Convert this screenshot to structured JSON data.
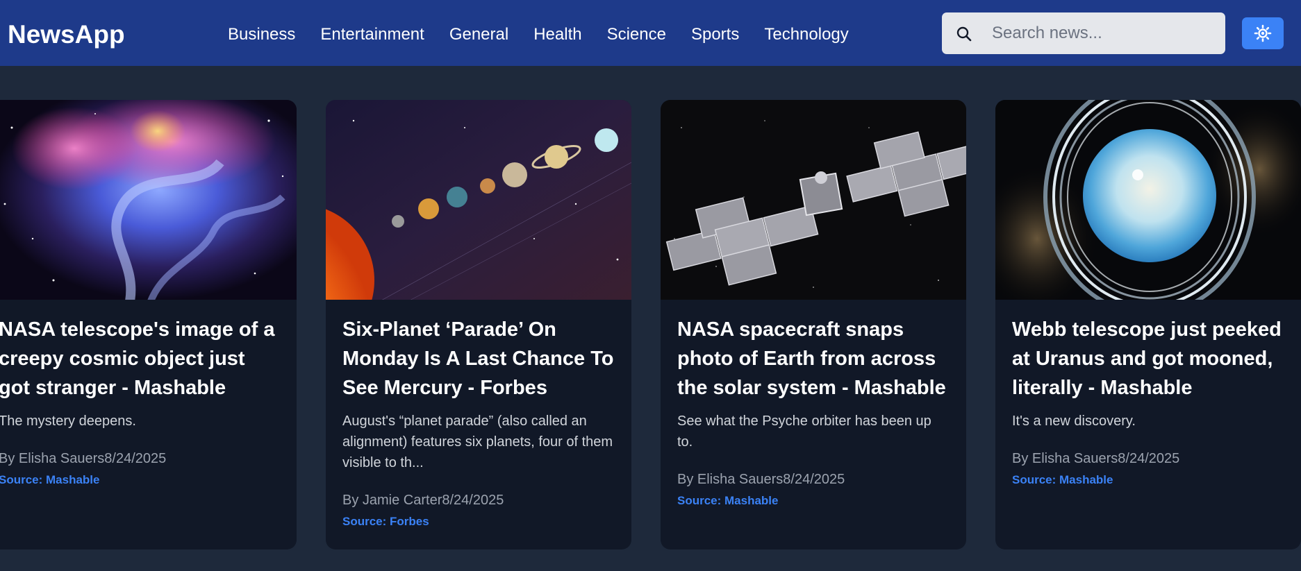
{
  "app": {
    "title": "NewsApp"
  },
  "nav": [
    "Business",
    "Entertainment",
    "General",
    "Health",
    "Science",
    "Sports",
    "Technology"
  ],
  "search": {
    "placeholder": "Search news...",
    "value": ""
  },
  "theme_toggle": {
    "icon": "sun-icon"
  },
  "colors": {
    "header": "#1e3a8a",
    "background": "#1e293b",
    "card": "#111827",
    "accent": "#3b82f6"
  },
  "articles": [
    {
      "title": "NASA telescope's image of a creepy cosmic object just got stranger - Mashable",
      "description": "The mystery deepens.",
      "byline": "By Elisha Sauers8/24/2025",
      "source": "Source: Mashable",
      "image": "nebula-image"
    },
    {
      "title": "Six-Planet ‘Parade’ On Monday Is A Last Chance To See Mercury - Forbes",
      "description": "August's “planet parade” (also called an alignment) features six planets, four of them visible to th...",
      "byline": "By Jamie Carter8/24/2025",
      "source": "Source: Forbes",
      "image": "planet-parade-image"
    },
    {
      "title": "NASA spacecraft snaps photo of Earth from across the solar system - Mashable",
      "description": "See what the Psyche orbiter has been up to.",
      "byline": "By Elisha Sauers8/24/2025",
      "source": "Source: Mashable",
      "image": "spacecraft-image"
    },
    {
      "title": "Webb telescope just peeked at Uranus and got mooned, literally - Mashable",
      "description": "It's a new discovery.",
      "byline": "By Elisha Sauers8/24/2025",
      "source": "Source: Mashable",
      "image": "uranus-image"
    }
  ]
}
